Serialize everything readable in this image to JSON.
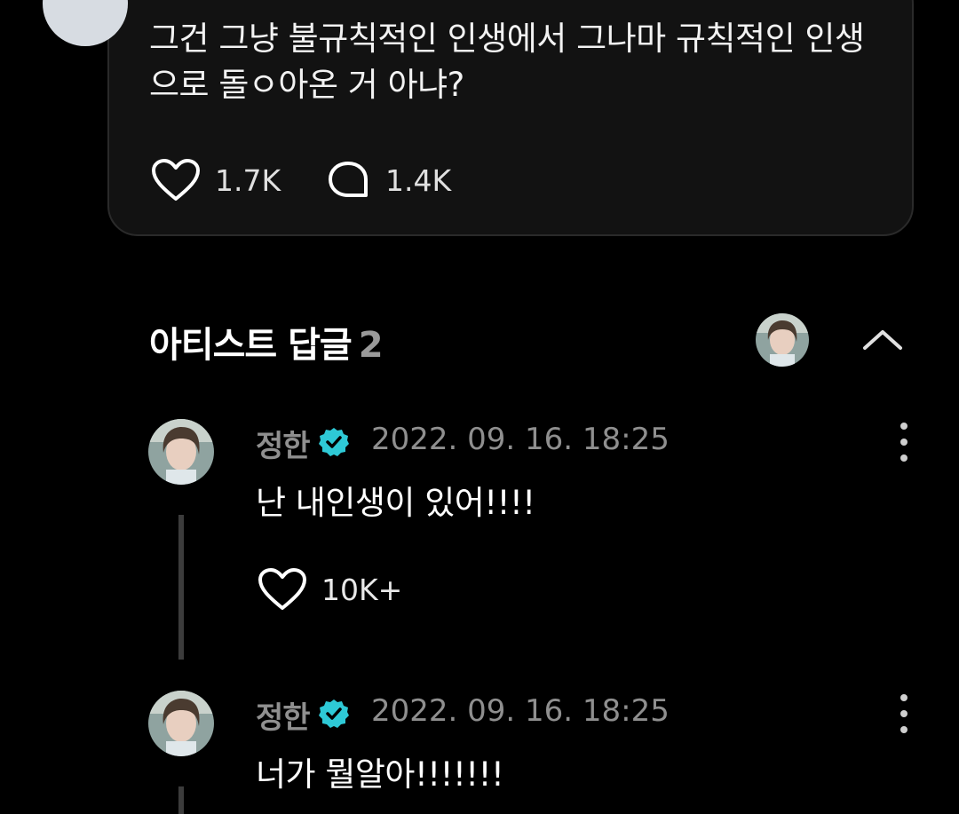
{
  "comment": {
    "text": "그건 그냥 불규칙적인 인생에서 그나마 규칙적인 인생으로 돌ㅇ아온 거 아냐?",
    "likes": "1.7K",
    "replies": "1.4K"
  },
  "artist_replies": {
    "title": "아티스트 답글",
    "count": "2"
  },
  "replies": [
    {
      "name": "정한",
      "time": "2022. 09. 16. 18:25",
      "text": "난 내인생이 있어!!!!",
      "likes": "10K+"
    },
    {
      "name": "정한",
      "time": "2022. 09. 16. 18:25",
      "text": "너가 뭘알아!!!!!!!"
    }
  ],
  "icons": {
    "like": "heart-outline-icon",
    "reply": "speech-bubble-icon",
    "verified": "verified-badge-icon",
    "collapse": "chevron-up-icon",
    "more": "more-vertical-icon"
  },
  "colors": {
    "background": "#000000",
    "card": "#121212",
    "verified": "#2ec9d6",
    "muted_text": "#8f8f8f"
  }
}
